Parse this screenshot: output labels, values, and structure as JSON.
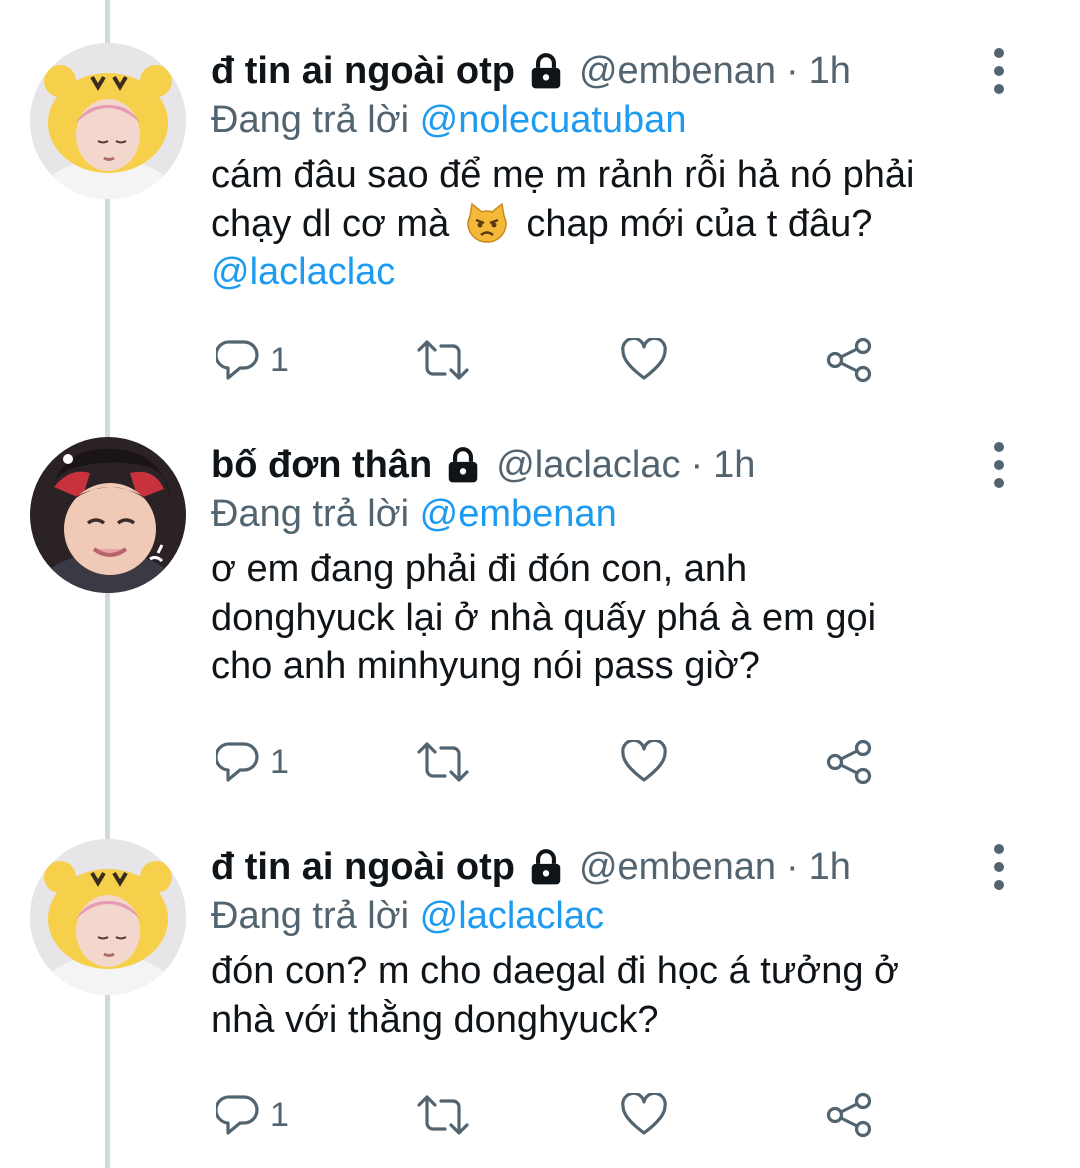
{
  "colors": {
    "text": "#0f1419",
    "secondary": "#536471",
    "link": "#1d9bf0",
    "thread_line": "#cfd9de"
  },
  "tweets": [
    {
      "display_name": "đ tin ai ngoài otp",
      "locked_icon": "lock-icon",
      "handle": "@embenan",
      "separator": "·",
      "time": "1h",
      "reply_prefix": "Đang trả lời",
      "reply_to": "@nolecuatuban",
      "body_line1": "cám đâu sao để mẹ m rảnh rỗi hả nó phải",
      "body_line2_before": "chạy dl cơ mà",
      "body_emoji": "pouting-cat-emoji",
      "body_line2_after": "chap mới của t đâu?",
      "body_mention": "@laclaclac",
      "reply_count": "1"
    },
    {
      "display_name": "bố đơn thân",
      "locked_icon": "lock-icon",
      "handle": "@laclaclac",
      "separator": "·",
      "time": "1h",
      "reply_prefix": "Đang trả lời",
      "reply_to": "@embenan",
      "body_line1": "ơ em đang phải đi đón con, anh",
      "body_line2": "donghyuck lại ở nhà quấy phá à em gọi",
      "body_line3": "cho anh minhyung nói pass giờ?",
      "reply_count": "1"
    },
    {
      "display_name": "đ tin ai ngoài otp",
      "locked_icon": "lock-icon",
      "handle": "@embenan",
      "separator": "·",
      "time": "1h",
      "reply_prefix": "Đang trả lời",
      "reply_to": "@laclaclac",
      "body_line1": "đón con? m cho daegal đi học á tưởng ở",
      "body_line2": "nhà với thằng donghyuck?",
      "reply_count": "1"
    }
  ]
}
